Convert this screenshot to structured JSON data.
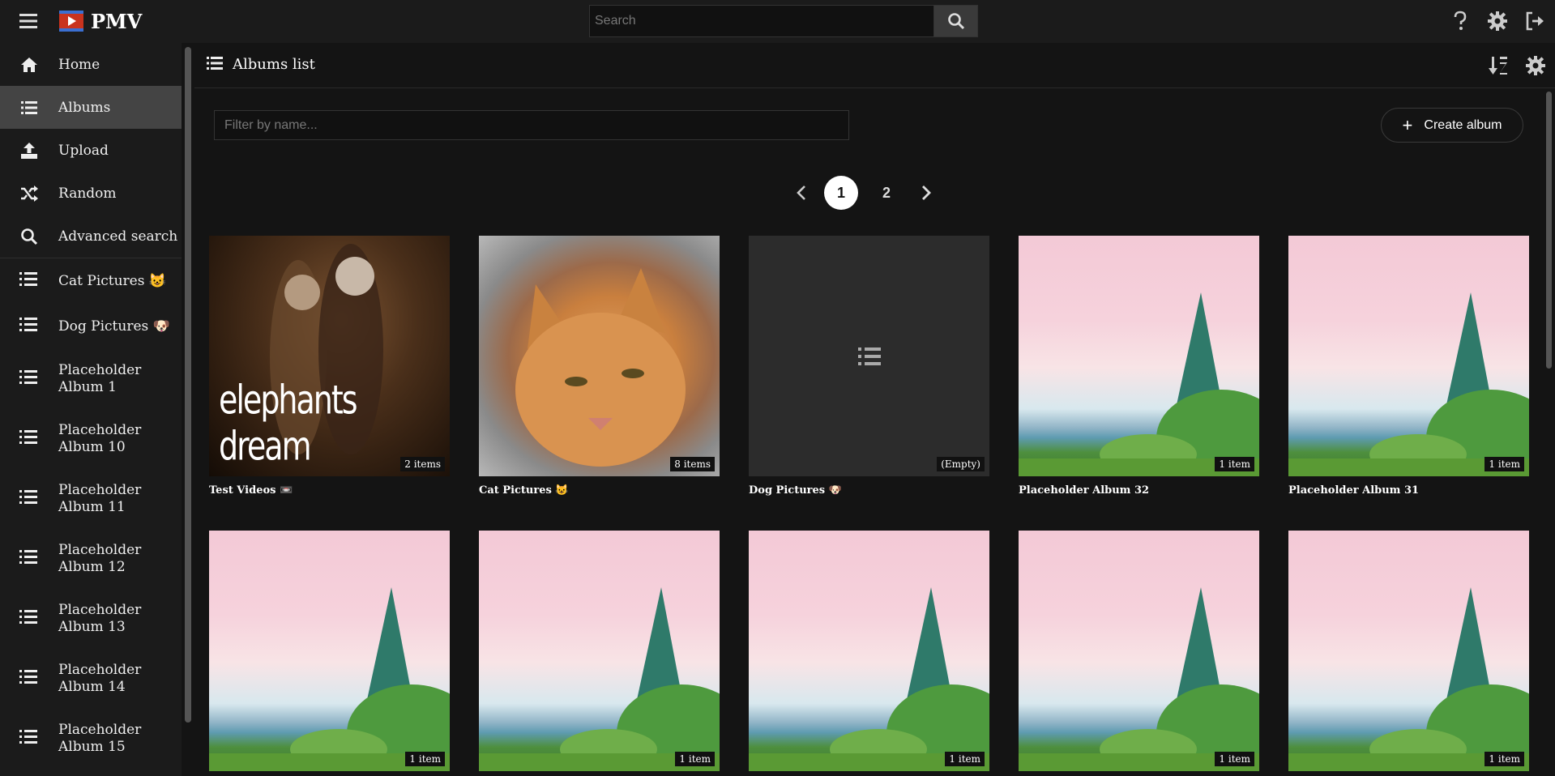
{
  "app": {
    "brand": "PMV"
  },
  "search": {
    "placeholder": "Search"
  },
  "sidebar": {
    "items": [
      {
        "label": "Home",
        "icon": "home-icon"
      },
      {
        "label": "Albums",
        "icon": "list-icon",
        "active": true
      },
      {
        "label": "Upload",
        "icon": "upload-icon"
      },
      {
        "label": "Random",
        "icon": "shuffle-icon"
      },
      {
        "label": "Advanced search",
        "icon": "search-icon"
      }
    ],
    "albums": [
      "Cat Pictures 😺",
      "Dog Pictures 🐶",
      "Placeholder Album 1",
      "Placeholder Album 10",
      "Placeholder Album 11",
      "Placeholder Album 12",
      "Placeholder Album 13",
      "Placeholder Album 14",
      "Placeholder Album 15"
    ]
  },
  "main": {
    "title": "Albums list",
    "filter_placeholder": "Filter by name...",
    "create_label": "Create album"
  },
  "pagination": {
    "pages": [
      "1",
      "2"
    ],
    "current": "1"
  },
  "cards": [
    {
      "title": "Test Videos 📼",
      "badge": "2 items",
      "thumb": "video"
    },
    {
      "title": "Cat Pictures 😺",
      "badge": "8 items",
      "thumb": "cat"
    },
    {
      "title": "Dog Pictures 🐶",
      "badge": "(Empty)",
      "thumb": "empty"
    },
    {
      "title": "Placeholder Album 32",
      "badge": "1 item",
      "thumb": "land"
    },
    {
      "title": "Placeholder Album 31",
      "badge": "1 item",
      "thumb": "land"
    },
    {
      "title": "",
      "badge": "1 item",
      "thumb": "land"
    },
    {
      "title": "",
      "badge": "1 item",
      "thumb": "land"
    },
    {
      "title": "",
      "badge": "1 item",
      "thumb": "land"
    },
    {
      "title": "",
      "badge": "1 item",
      "thumb": "land"
    },
    {
      "title": "",
      "badge": "1 item",
      "thumb": "land"
    }
  ],
  "thumb_video_caption": "elephants dream"
}
